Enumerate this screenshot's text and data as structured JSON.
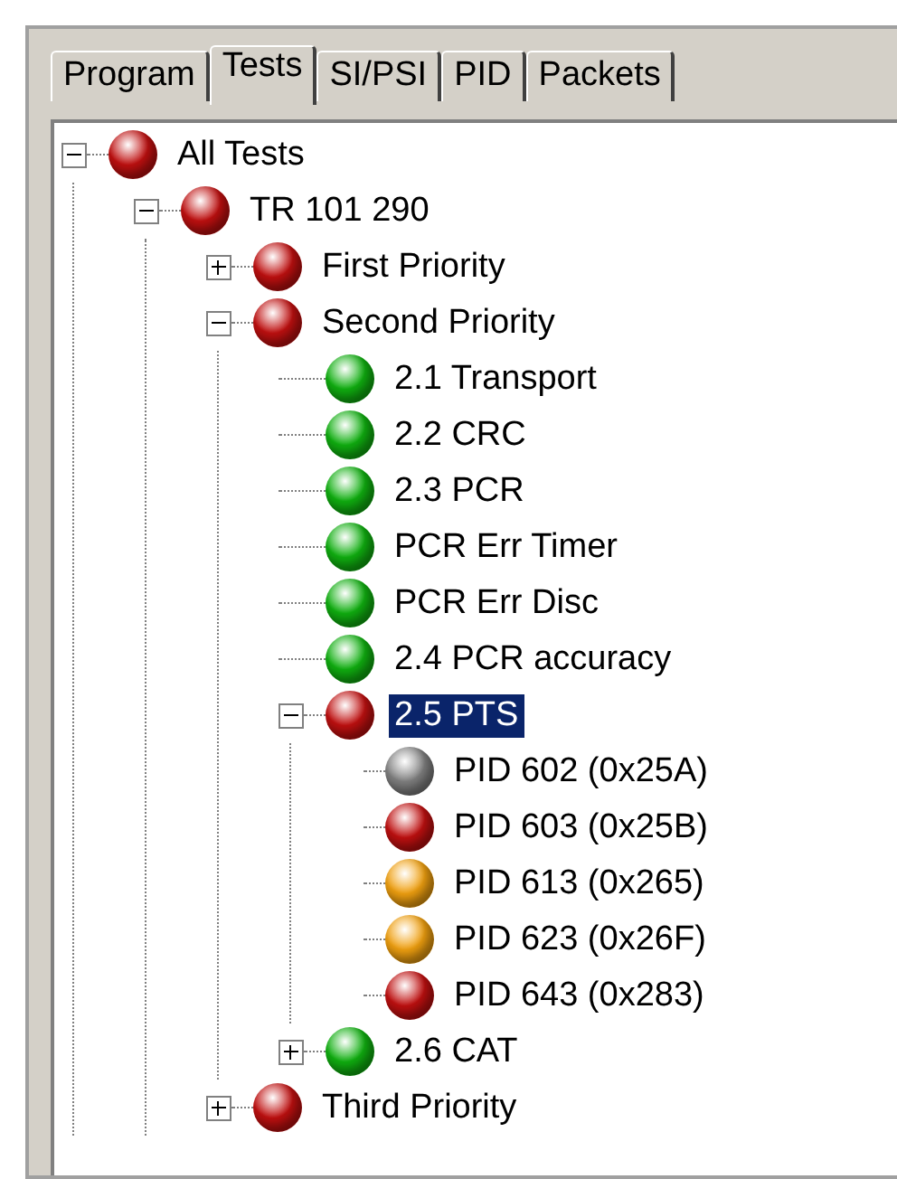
{
  "tabs": [
    {
      "label": "Program",
      "selected": false
    },
    {
      "label": "Tests",
      "selected": true
    },
    {
      "label": "SI/PSI",
      "selected": false
    },
    {
      "label": "PID",
      "selected": false
    },
    {
      "label": "Packets",
      "selected": false
    }
  ],
  "tree": [
    {
      "label": "All Tests",
      "color": "#c01010",
      "expanded": true,
      "selected": false,
      "children": [
        {
          "label": "TR 101 290",
          "color": "#c01010",
          "expanded": true,
          "selected": false,
          "children": [
            {
              "label": "First Priority",
              "color": "#c01010",
              "expanded": false,
              "selected": false
            },
            {
              "label": "Second Priority",
              "color": "#c01010",
              "expanded": true,
              "selected": false,
              "children": [
                {
                  "label": "2.1 Transport",
                  "color": "#10b010",
                  "selected": false
                },
                {
                  "label": "2.2 CRC",
                  "color": "#10b010",
                  "selected": false
                },
                {
                  "label": "2.3 PCR",
                  "color": "#10b010",
                  "selected": false
                },
                {
                  "label": "PCR Err Timer",
                  "color": "#10b010",
                  "selected": false
                },
                {
                  "label": "PCR Err Disc",
                  "color": "#10b010",
                  "selected": false
                },
                {
                  "label": "2.4 PCR accuracy",
                  "color": "#10b010",
                  "selected": false
                },
                {
                  "label": "2.5 PTS",
                  "color": "#c01010",
                  "expanded": true,
                  "selected": true,
                  "children": [
                    {
                      "label": "PID 602 (0x25A)",
                      "color": "#808080",
                      "selected": false
                    },
                    {
                      "label": "PID 603 (0x25B)",
                      "color": "#c01010",
                      "selected": false
                    },
                    {
                      "label": "PID 613 (0x265)",
                      "color": "#f0a010",
                      "selected": false
                    },
                    {
                      "label": "PID 623 (0x26F)",
                      "color": "#f0a010",
                      "selected": false
                    },
                    {
                      "label": "PID 643 (0x283)",
                      "color": "#c01010",
                      "selected": false
                    }
                  ]
                },
                {
                  "label": "2.6 CAT",
                  "color": "#10b010",
                  "expanded": false,
                  "selected": false
                }
              ]
            },
            {
              "label": "Third Priority",
              "color": "#c01010",
              "expanded": false,
              "selected": false
            }
          ]
        }
      ]
    }
  ]
}
